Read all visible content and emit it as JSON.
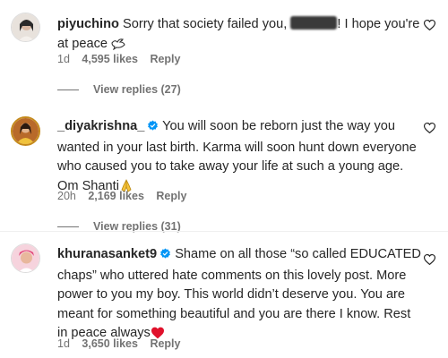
{
  "comments": [
    {
      "username": "piyuchino",
      "text_before": "Sorry that society failed you,",
      "text_after": "! I hope you're at peace",
      "age": "1d",
      "likes": "4,595 likes",
      "reply": "Reply",
      "view_replies": "View replies (27)"
    },
    {
      "username": "_diyakrishna_",
      "text": "You will soon be reborn just the way you wanted in your last birth. Karma will soon hunt down everyone who caused you to take away your life at such a young age. Om Shanti",
      "age": "20h",
      "likes": "2,169 likes",
      "reply": "Reply",
      "view_replies": "View replies (31)"
    },
    {
      "username": "khuranasanket9",
      "text": "Shame on all those “so called EDUCATED chaps” who uttered hate comments on this lovely post. More power to you my boy. This world didn’t deserve you. You are meant for something beautiful and you are there I know. Rest in peace always",
      "age": "1d",
      "likes": "3,650 likes",
      "reply": "Reply"
    }
  ],
  "icons": {
    "like": "heart-outline-icon",
    "verified": "verified-badge-icon",
    "dove": "dove-emoji",
    "pray": "folded-hands-emoji",
    "red_heart": "red-heart-emoji"
  },
  "colors": {
    "text": "#262626",
    "secondary": "#737373",
    "verified": "#0095f6",
    "red_heart": "#e0112b"
  }
}
